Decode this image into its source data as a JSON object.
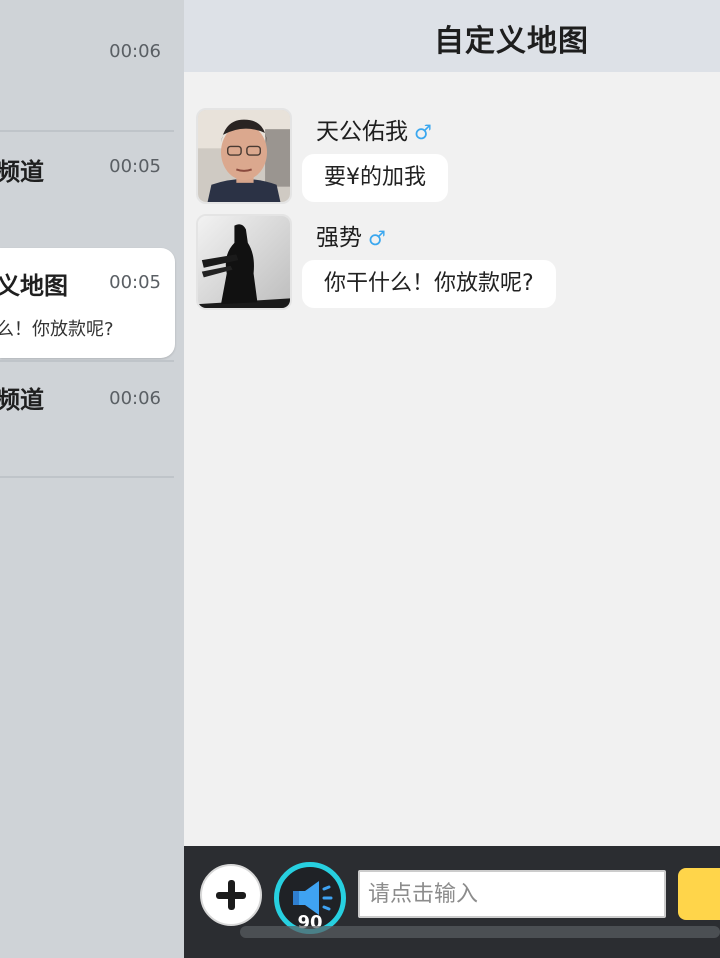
{
  "sidebar": {
    "items": [
      {
        "title": "",
        "time": "00:06",
        "preview": ""
      },
      {
        "title": "频道",
        "time": "00:05",
        "preview": ""
      },
      {
        "title": "义地图",
        "time": "00:05",
        "preview": "么！你放款呢?"
      },
      {
        "title": "频道",
        "time": "00:06",
        "preview": ""
      }
    ]
  },
  "header": {
    "title": "自定义地图"
  },
  "messages": [
    {
      "name": "天公佑我",
      "gender_icon": "♂",
      "text": "要¥的加我"
    },
    {
      "name": "强势",
      "gender_icon": "♂",
      "text": "你干什么！你放款呢?"
    }
  ],
  "input": {
    "placeholder": "请点击输入",
    "voice_count": "90"
  },
  "colors": {
    "accent_cyan": "#27d0e0",
    "send_yellow": "#ffd54a",
    "gender_blue": "#3aa7ef"
  }
}
